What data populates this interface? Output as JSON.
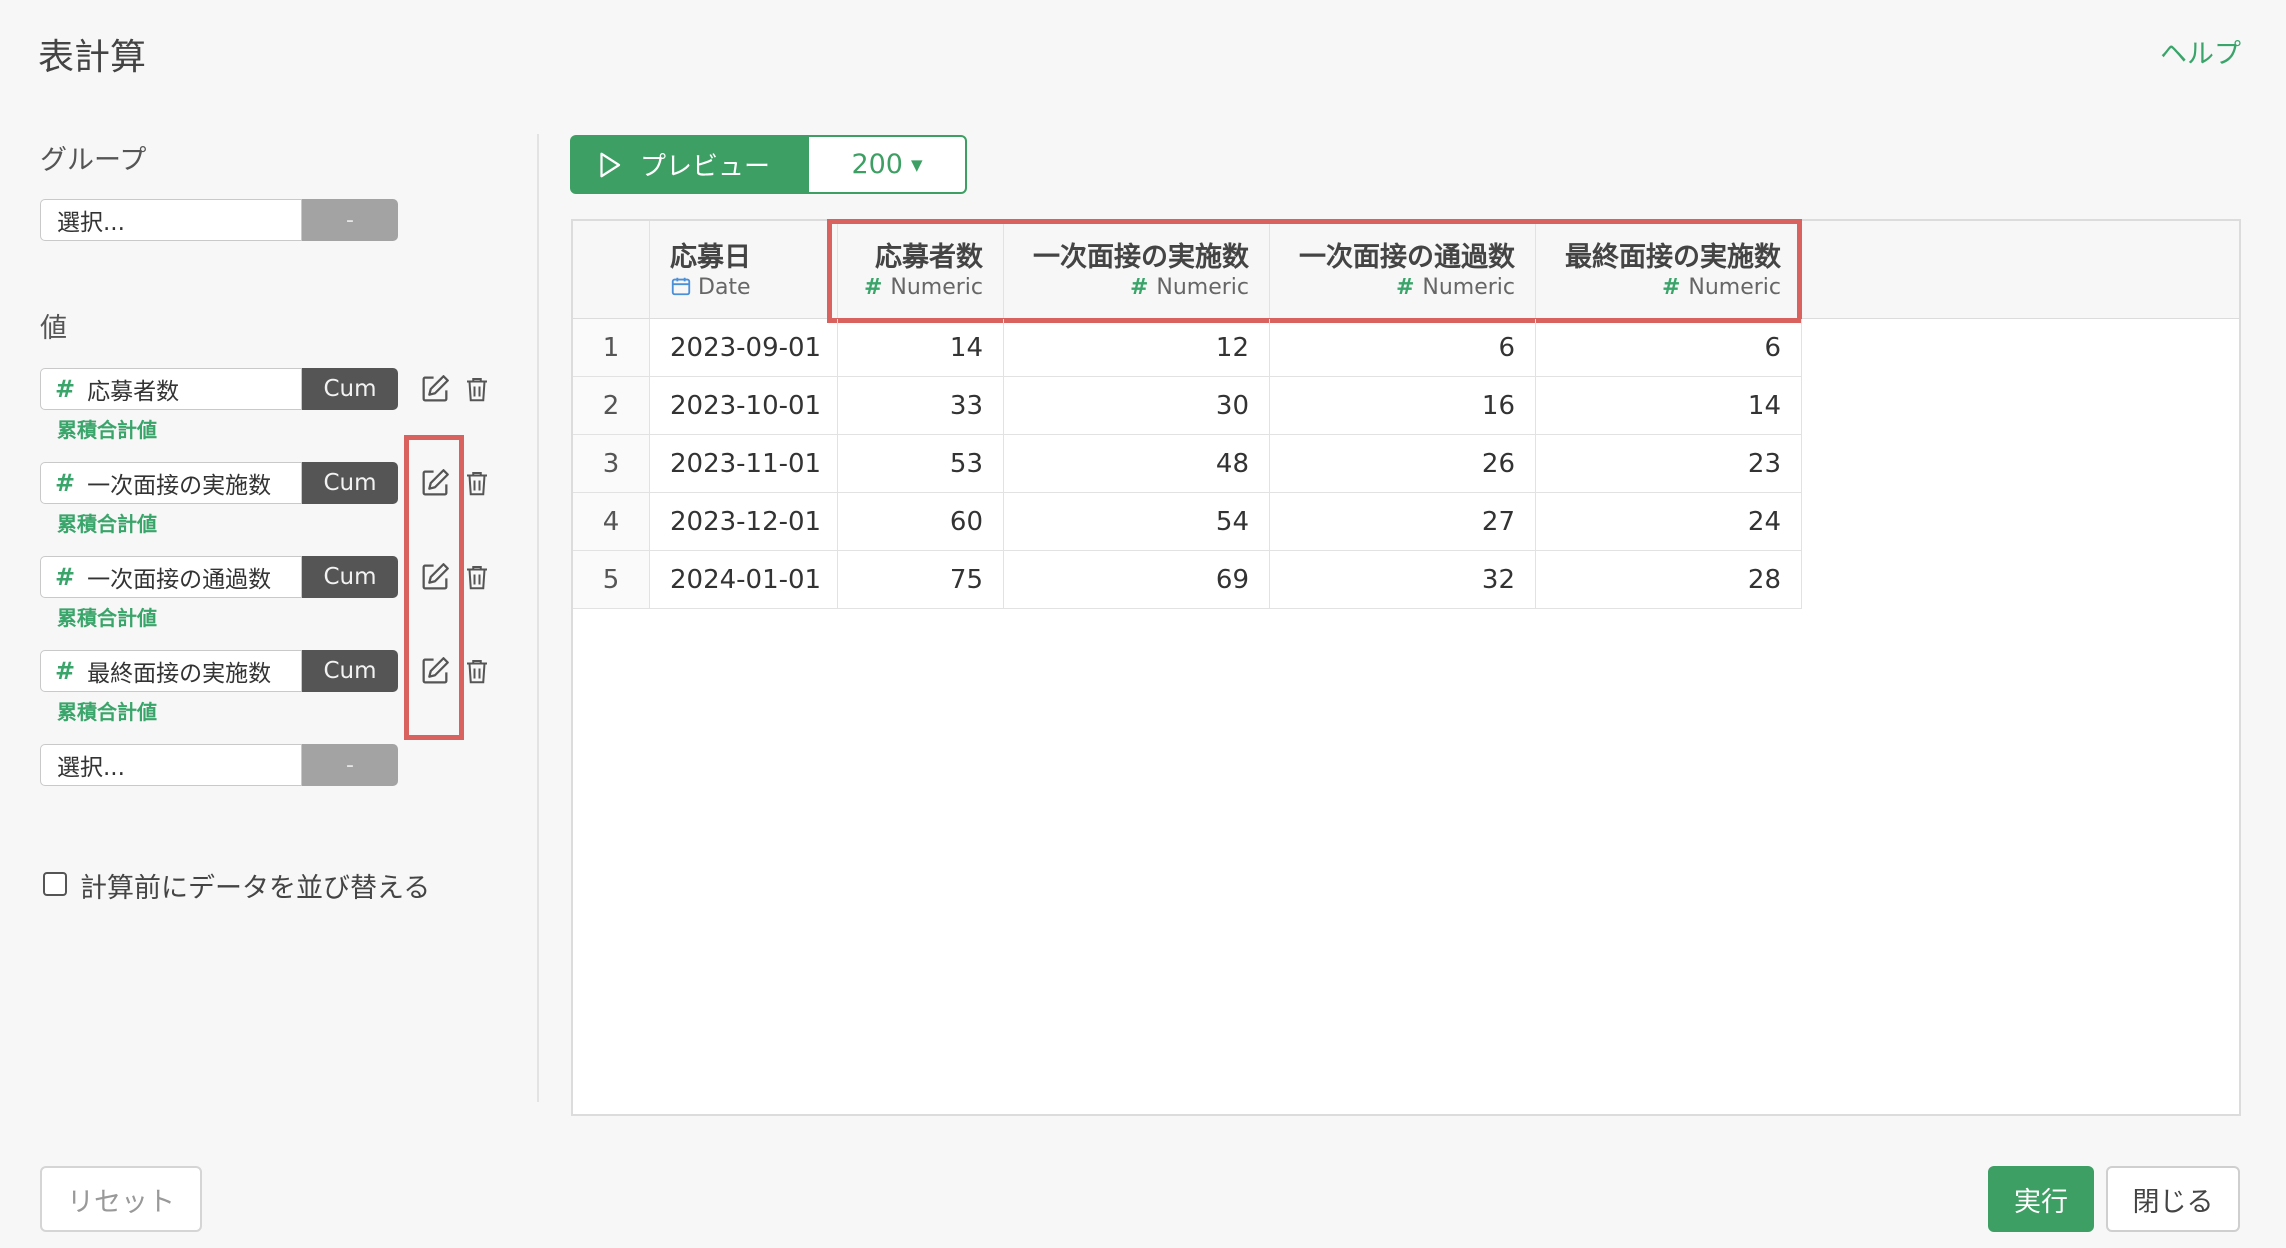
{
  "dialog": {
    "title": "表計算",
    "help_label": "ヘルプ"
  },
  "group": {
    "label": "グループ",
    "placeholder": "選択...",
    "button": "-"
  },
  "values": {
    "label": "値",
    "items": [
      {
        "name": "応募者数",
        "calc_button": "Cum",
        "calc_label": "累積合計値"
      },
      {
        "name": "一次面接の実施数",
        "calc_button": "Cum",
        "calc_label": "累積合計値"
      },
      {
        "name": "一次面接の通過数",
        "calc_button": "Cum",
        "calc_label": "累積合計値"
      },
      {
        "name": "最終面接の実施数",
        "calc_button": "Cum",
        "calc_label": "累積合計値"
      }
    ],
    "new_placeholder": "選択...",
    "new_button": "-"
  },
  "sort_option": {
    "label": "計算前にデータを並び替える",
    "checked": false
  },
  "preview": {
    "button_label": "プレビュー",
    "row_count": "200"
  },
  "table": {
    "columns": [
      {
        "name": "応募日",
        "type": "Date"
      },
      {
        "name": "応募者数",
        "type": "Numeric"
      },
      {
        "name": "一次面接の実施数",
        "type": "Numeric"
      },
      {
        "name": "一次面接の通過数",
        "type": "Numeric"
      },
      {
        "name": "最終面接の実施数",
        "type": "Numeric"
      }
    ],
    "rows": [
      {
        "index": "1",
        "cells": [
          "2023-09-01",
          "14",
          "12",
          "6",
          "6"
        ]
      },
      {
        "index": "2",
        "cells": [
          "2023-10-01",
          "33",
          "30",
          "16",
          "14"
        ]
      },
      {
        "index": "3",
        "cells": [
          "2023-11-01",
          "53",
          "48",
          "26",
          "23"
        ]
      },
      {
        "index": "4",
        "cells": [
          "2023-12-01",
          "60",
          "54",
          "27",
          "24"
        ]
      },
      {
        "index": "5",
        "cells": [
          "2024-01-01",
          "75",
          "69",
          "32",
          "28"
        ]
      }
    ]
  },
  "footer": {
    "reset_label": "リセット",
    "run_label": "実行",
    "close_label": "閉じる"
  },
  "colors": {
    "accent": "#3e9f64",
    "highlight": "#d9625f",
    "cum_button": "#555555"
  },
  "icons": {
    "edit": "edit-icon",
    "delete": "trash-icon",
    "play": "play-icon",
    "date_type": "calendar-icon",
    "numeric_type": "hash-icon"
  }
}
